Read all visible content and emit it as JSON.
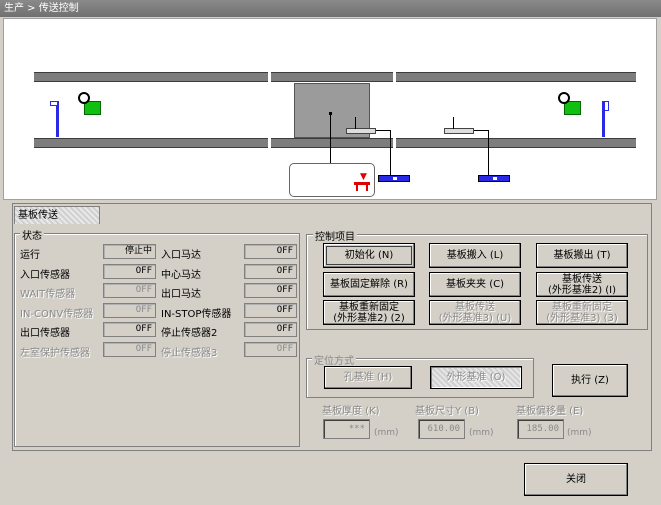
{
  "window": {
    "title": "生产 > 传送控制"
  },
  "tab": {
    "label": "基板传送"
  },
  "status": {
    "title": "状态",
    "left": [
      {
        "label": "运行",
        "value": "停止中",
        "disabled": false
      },
      {
        "label": "入口传感器",
        "value": "OFF",
        "disabled": false
      },
      {
        "label": "WAIT传感器",
        "value": "OFF",
        "disabled": true
      },
      {
        "label": "IN-CONV传感器",
        "value": "OFF",
        "disabled": true
      },
      {
        "label": "出口传感器",
        "value": "OFF",
        "disabled": false
      },
      {
        "label": "左室保护传感器",
        "value": "OFF",
        "disabled": true
      }
    ],
    "right": [
      {
        "label": "入口马达",
        "value": "OFF",
        "disabled": false
      },
      {
        "label": "中心马达",
        "value": "OFF",
        "disabled": false
      },
      {
        "label": "出口马达",
        "value": "OFF",
        "disabled": false
      },
      {
        "label": "IN-STOP传感器",
        "value": "OFF",
        "disabled": false
      },
      {
        "label": "停止传感器2",
        "value": "OFF",
        "disabled": false
      },
      {
        "label": "停止传感器3",
        "value": "OFF",
        "disabled": true
      }
    ]
  },
  "control": {
    "title": "控制项目",
    "buttons": [
      {
        "label": "初始化 (N)",
        "disabled": false
      },
      {
        "label": "基板搬入 (L)",
        "disabled": false
      },
      {
        "label": "基板搬出 (T)",
        "disabled": false
      },
      {
        "label": "基板固定解除 (R)",
        "disabled": false
      },
      {
        "label": "基板夹夹 (C)",
        "disabled": false
      },
      {
        "label": "基板传送\n(外形基准2) (I)",
        "disabled": false
      },
      {
        "label": "基板重新固定\n(外形基准2) (2)",
        "disabled": false
      },
      {
        "label": "基板传送\n(外形基准3) (U)",
        "disabled": true
      },
      {
        "label": "基板重新固定\n(外形基准3) (3)",
        "disabled": true
      }
    ]
  },
  "positioning": {
    "title": "定位方式",
    "hole_label": "孔基准 (H)",
    "outline_label": "外形基准 (O)"
  },
  "execute_label": "执行 (Z)",
  "params": {
    "thickness_label": "基板厚度 (K)",
    "thickness_value": "***",
    "size_label": "基板尺寸Y (B)",
    "size_value": "610.00",
    "speed_label": "基板偏移量 (E)",
    "speed_value": "185.00",
    "unit": "(mm)"
  },
  "close_label": "关闭"
}
